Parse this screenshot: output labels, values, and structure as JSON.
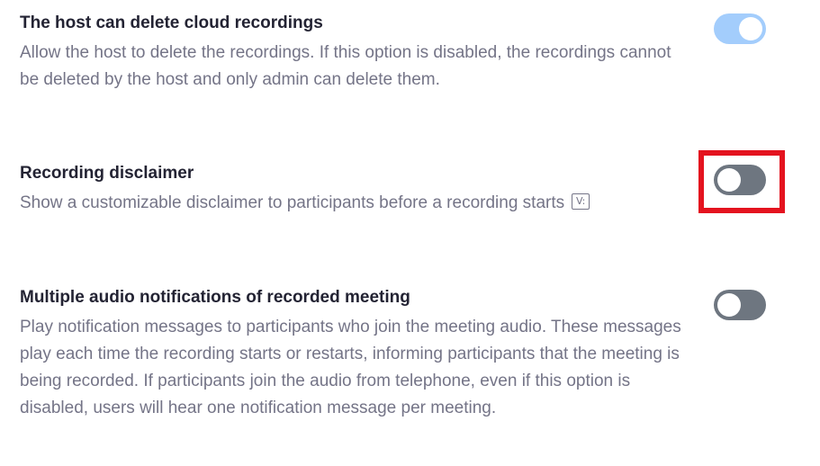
{
  "settings": [
    {
      "title": "The host can delete cloud recordings",
      "description": "Allow the host to delete the recordings. If this option is disabled, the recordings cannot be deleted by the host and only admin can delete them.",
      "enabled": true,
      "toggle_color": "#a3cdfc"
    },
    {
      "title": "Recording disclaimer",
      "description": "Show a customizable disclaimer to participants before a recording starts",
      "icon": "verified-v-icon",
      "icon_glyph": "V:",
      "enabled": false,
      "toggle_color": "#6e7680",
      "highlighted": true,
      "highlight_color": "#e4131f"
    },
    {
      "title": "Multiple audio notifications of recorded meeting",
      "description": "Play notification messages to participants who join the meeting audio. These messages play each time the recording starts or restarts, informing participants that the meeting is being recorded. If participants join the audio from telephone, even if this option is disabled, users will hear one notification message per meeting.",
      "enabled": false,
      "toggle_color": "#6e7680"
    }
  ]
}
